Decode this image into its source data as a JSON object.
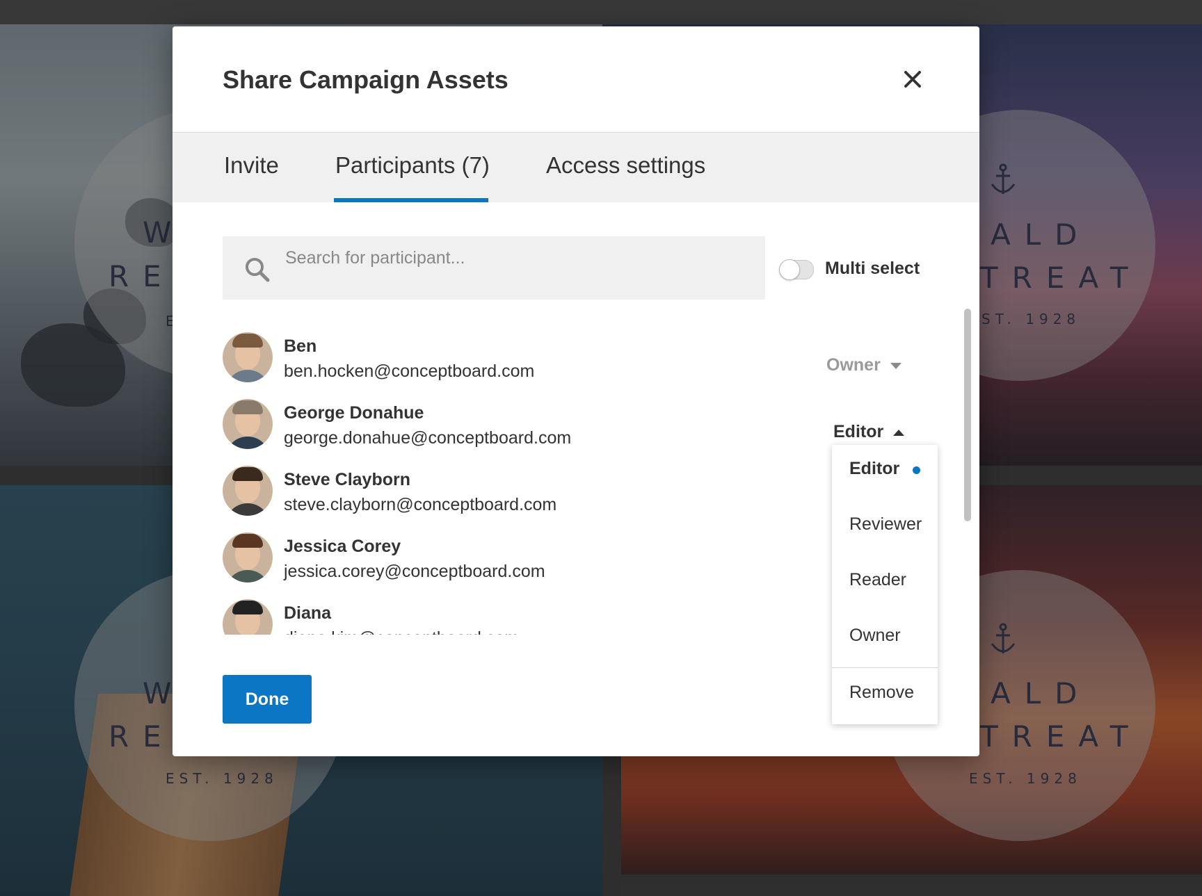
{
  "background": {
    "brand_top_left_1": "W",
    "brand_top_left_2": "RE",
    "brand_top_left_3": "E",
    "brand_top_right_1": "ALD",
    "brand_top_right_2": "TREAT",
    "brand_top_right_3": "ST. 1928",
    "brand_bottom_left_1": "W",
    "brand_bottom_left_2": "RE",
    "brand_bottom_left_3": "EST. 1928",
    "brand_bottom_right_1": "ALD",
    "brand_bottom_right_2": "TREAT",
    "brand_bottom_right_3": "EST. 1928"
  },
  "modal": {
    "title": "Share Campaign Assets",
    "close_icon": "close-icon"
  },
  "tabs": [
    {
      "label": "Invite",
      "active": false
    },
    {
      "label": "Participants (7)",
      "active": true
    },
    {
      "label": "Access settings",
      "active": false
    }
  ],
  "search": {
    "placeholder": "Search for participant...",
    "value": "",
    "icon": "search-icon"
  },
  "multi_select": {
    "label": "Multi select",
    "enabled": false
  },
  "participants": [
    {
      "name": "Ben",
      "email": "ben.hocken@conceptboard.com",
      "role": "Owner"
    },
    {
      "name": "George Donahue",
      "email": "george.donahue@conceptboard.com",
      "role": "Editor"
    },
    {
      "name": "Steve Clayborn",
      "email": "steve.clayborn@conceptboard.com",
      "role": ""
    },
    {
      "name": "Jessica Corey",
      "email": "jessica.corey@conceptboard.com",
      "role": ""
    },
    {
      "name": "Diana",
      "email": "diana.kim@conceptboard.com",
      "role": ""
    }
  ],
  "role_menu": {
    "options": [
      "Editor",
      "Reviewer",
      "Reader",
      "Owner"
    ],
    "selected": "Editor",
    "remove_label": "Remove"
  },
  "footer": {
    "done_label": "Done"
  },
  "colors": {
    "accent": "#0a76c4",
    "tab_bar": "#f0f0f0",
    "text": "#333333",
    "muted": "#9a9a9a"
  }
}
